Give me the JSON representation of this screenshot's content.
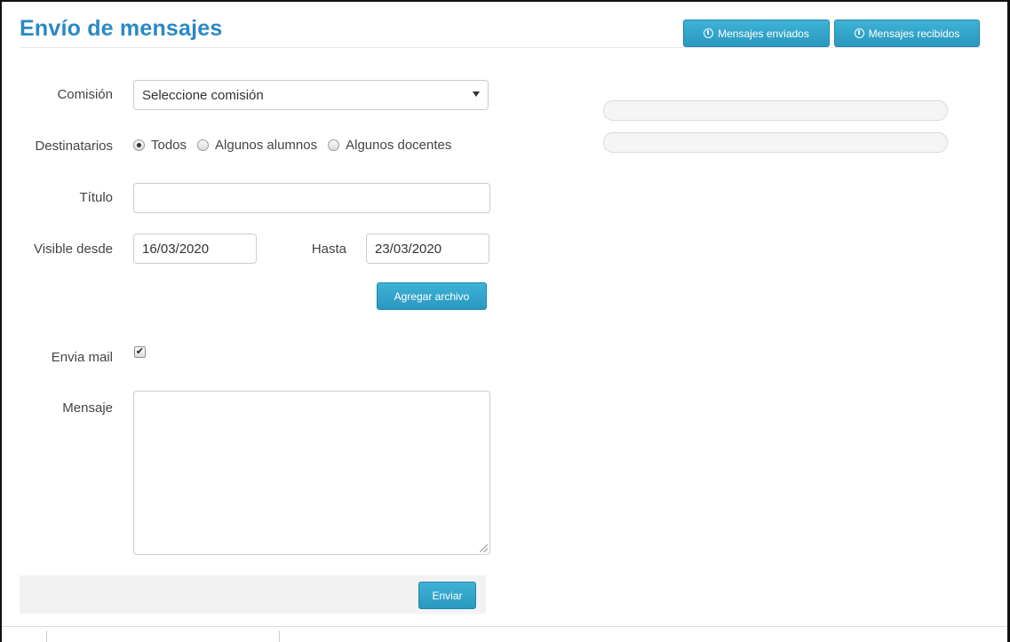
{
  "header": {
    "title": "Envío de mensajes",
    "sent_button": "Mensajes enviados",
    "received_button": "Mensajes recibidos",
    "button_icon": "info-circle-icon"
  },
  "form": {
    "comision": {
      "label": "Comisión",
      "value": "Seleccione comisión"
    },
    "destinatarios": {
      "label": "Destinatarios",
      "options": [
        "Todos",
        "Algunos alumnos",
        "Algunos docentes"
      ],
      "selected": "Todos"
    },
    "titulo": {
      "label": "Título",
      "value": ""
    },
    "visible_desde": {
      "label": "Visible desde",
      "value": "16/03/2020"
    },
    "hasta": {
      "label": "Hasta",
      "value": "23/03/2020"
    },
    "agregar_archivo": "Agregar archivo",
    "envia_mail": {
      "label": "Envia mail",
      "checked": true
    },
    "mensaje": {
      "label": "Mensaje",
      "value": ""
    },
    "enviar": "Enviar"
  },
  "colors": {
    "title": "#2a88c6",
    "button": "#2a98bf"
  }
}
